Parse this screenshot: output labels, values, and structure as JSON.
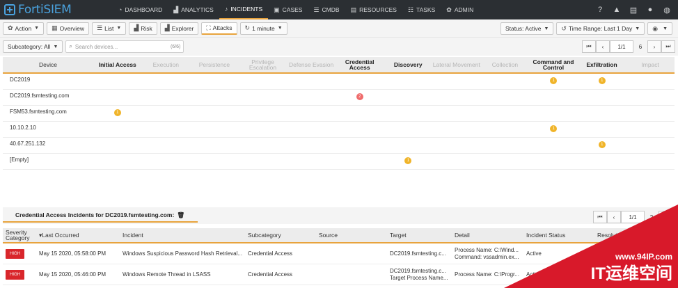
{
  "app": {
    "logo": "FortiSIEM"
  },
  "nav": {
    "items": [
      {
        "label": "DASHBOARD",
        "icon": "speedometer-icon",
        "glyph": "◔"
      },
      {
        "label": "ANALYTICS",
        "icon": "chart-icon",
        "glyph": "▟"
      },
      {
        "label": "INCIDENTS",
        "icon": "bell-icon",
        "glyph": "♪"
      },
      {
        "label": "CASES",
        "icon": "briefcase-icon",
        "glyph": "▣"
      },
      {
        "label": "CMDB",
        "icon": "database-icon",
        "glyph": "☰"
      },
      {
        "label": "RESOURCES",
        "icon": "book-icon",
        "glyph": "▤"
      },
      {
        "label": "TASKS",
        "icon": "tasks-icon",
        "glyph": "☷"
      },
      {
        "label": "ADMIN",
        "icon": "gears-icon",
        "glyph": "✿"
      }
    ],
    "active_index": 2
  },
  "toolbar": {
    "action": "Action",
    "overview": "Overview",
    "list": "List",
    "risk": "Risk",
    "explorer": "Explorer",
    "attacks": "Attacks",
    "refresh": "1 minute",
    "status": "Status: Active",
    "time_range": "Time Range: Last 1 Day"
  },
  "filter": {
    "subcategory": "Subcategory: All",
    "search_placeholder": "Search devices...",
    "search_count": "(6/6)",
    "page": "1/1",
    "total": "6"
  },
  "matrix": {
    "device_header": "Device",
    "columns": [
      {
        "label": "Initial Access",
        "active": true
      },
      {
        "label": "Execution",
        "active": false
      },
      {
        "label": "Persistence",
        "active": false
      },
      {
        "label": "Privilege Escalation",
        "active": false
      },
      {
        "label": "Defense Evasion",
        "active": false
      },
      {
        "label": "Credential Access",
        "active": true
      },
      {
        "label": "Discovery",
        "active": true
      },
      {
        "label": "Lateral Movement",
        "active": false
      },
      {
        "label": "Collection",
        "active": false
      },
      {
        "label": "Command and Control",
        "active": true
      },
      {
        "label": "Exfiltration",
        "active": true
      },
      {
        "label": "Impact",
        "active": false
      }
    ],
    "rows": [
      {
        "device": "DC2019",
        "cells": [
          {
            "col": 9,
            "count": "1",
            "color": "#f0b429"
          },
          {
            "col": 10,
            "count": "1",
            "color": "#f0b429"
          }
        ]
      },
      {
        "device": "DC2019.fsmtesting.com",
        "cells": [
          {
            "col": 5,
            "count": "2",
            "color": "#ef6b6b"
          }
        ]
      },
      {
        "device": "FSM53.fsmtesting.com",
        "cells": [
          {
            "col": 0,
            "count": "1",
            "color": "#f0b429"
          }
        ]
      },
      {
        "device": "10.10.2.10",
        "cells": [
          {
            "col": 9,
            "count": "1",
            "color": "#f0b429"
          }
        ]
      },
      {
        "device": "40.67.251.132",
        "cells": [
          {
            "col": 10,
            "count": "1",
            "color": "#f0b429"
          }
        ]
      },
      {
        "device": "[Empty]",
        "cells": [
          {
            "col": 6,
            "count": "1",
            "color": "#f0b429"
          }
        ]
      }
    ]
  },
  "incidents_panel": {
    "title": "Credential Access Incidents for DC2019.fsmtesting.com:",
    "page": "1/1",
    "total": "2",
    "headers": [
      "Severity Category",
      "Last Occurred",
      "Incident",
      "Subcategory",
      "Source",
      "Target",
      "Detail",
      "Incident Status",
      "Resolution"
    ],
    "rows": [
      {
        "severity": "HIGH",
        "last_occurred": "May 15 2020, 05:58:00 PM",
        "incident": "Windows Suspicious Password Hash Retrieval...",
        "subcategory": "Credential Access",
        "source": "",
        "target": [
          "DC2019.fsmtesting.c..."
        ],
        "detail": [
          "Process Name: C:\\Wind...",
          "Command: vssadmin.ex..."
        ],
        "status": "Active"
      },
      {
        "severity": "HIGH",
        "last_occurred": "May 15 2020, 05:46:00 PM",
        "incident": "Windows Remote Thread in LSASS",
        "subcategory": "Credential Access",
        "source": "",
        "target": [
          "DC2019.fsmtesting.c...",
          "Target Process Name..."
        ],
        "detail": [
          "Process Name: C:\\Progr..."
        ],
        "status": "Active"
      }
    ]
  },
  "watermark": {
    "url": "www.94IP.com",
    "brand": "IT运维空间"
  }
}
